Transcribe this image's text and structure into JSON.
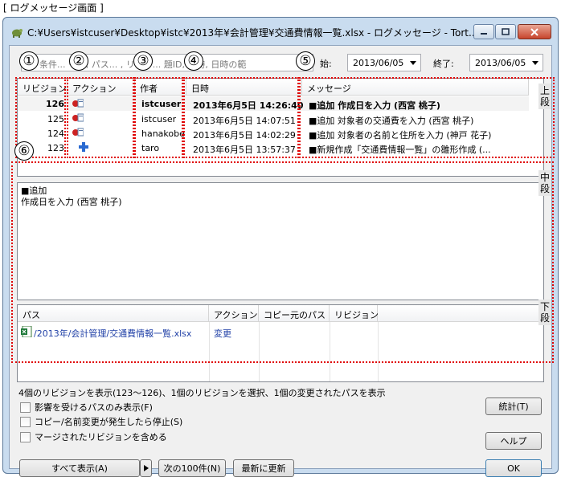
{
  "caption": "[ ログメッセージ画面 ]",
  "window": {
    "title": "C:¥Users¥istcuser¥Desktop¥istc¥2013年¥会計管理¥交通費情報一覧.xlsx - ログメッセージ - Tort..."
  },
  "filter": {
    "placeholder": "検索条件 (メッセージ, パス, 作者, リビジョン, 課題ID, 日時, 日時の範囲)",
    "visible_text": "条件... ージ, パス... , リビジ... 題ID, 日時, 日時の範",
    "from_label": "始:",
    "from_value": "2013/06/05",
    "to_label": "終了:",
    "to_value": "2013/06/05"
  },
  "revisions": {
    "headers": [
      "リビジョン",
      "アクション",
      "作者",
      "日時",
      "メッセージ"
    ],
    "rows": [
      {
        "rev": "126",
        "author": "istcuser",
        "date": "2013年6月5日 14:26:40",
        "message": "■追加 作成日を入力 (西宮 桃子)",
        "actions": [
          "modified-icon"
        ],
        "bold": true
      },
      {
        "rev": "125",
        "author": "istcuser",
        "date": "2013年6月5日 14:07:51",
        "message": "■追加 対象者の交通費を入力 (西宮 桃子)",
        "actions": [
          "modified-icon"
        ],
        "bold": false
      },
      {
        "rev": "124",
        "author": "hanakobe",
        "date": "2013年6月5日 14:02:29",
        "message": "■追加 対象者の名前と住所を入力 (神戸 花子)",
        "actions": [
          "modified-icon"
        ],
        "bold": false
      },
      {
        "rev": "123",
        "author": "taro",
        "date": "2013年6月5日 13:57:37",
        "message": "■新規作成「交通費情報一覧」の雛形作成 (...",
        "actions": [
          "added-icon"
        ],
        "bold": false
      }
    ]
  },
  "detail": {
    "line1": "■追加",
    "line2": "作成日を入力 (西宮 桃子)"
  },
  "paths": {
    "headers": [
      "パス",
      "アクション",
      "コピー元のパス",
      "リビジョン"
    ],
    "rows": [
      {
        "path": "/2013年/会計管理/交通費情報一覧.xlsx",
        "action": "変更",
        "copyfrom": "",
        "revision": ""
      }
    ]
  },
  "status_text": "4個のリビジョンを表示(123〜126)、1個のリビジョンを選択、1個の変更されたパスを表示",
  "checkboxes": [
    {
      "label": "影響を受けるパスのみ表示(F)",
      "checked": false
    },
    {
      "label": "コピー/名前変更が発生したら停止(S)",
      "checked": false
    },
    {
      "label": "マージされたリビジョンを含める",
      "checked": false
    }
  ],
  "buttons": {
    "show_all": "すべて表示(A)",
    "next_100": "次の100件(N)",
    "refresh": "最新に更新",
    "stats": "統計(T)",
    "help": "ヘルプ",
    "ok": "OK"
  },
  "annotations": {
    "numbers": [
      "①",
      "②",
      "③",
      "④",
      "⑤",
      "⑥"
    ],
    "upper": "上段",
    "middle": "中段",
    "lower": "下段"
  },
  "colors": {
    "annotation_red": "#e00000",
    "link_blue": "#1f3fa6",
    "window_frame": "#c9dcef"
  }
}
